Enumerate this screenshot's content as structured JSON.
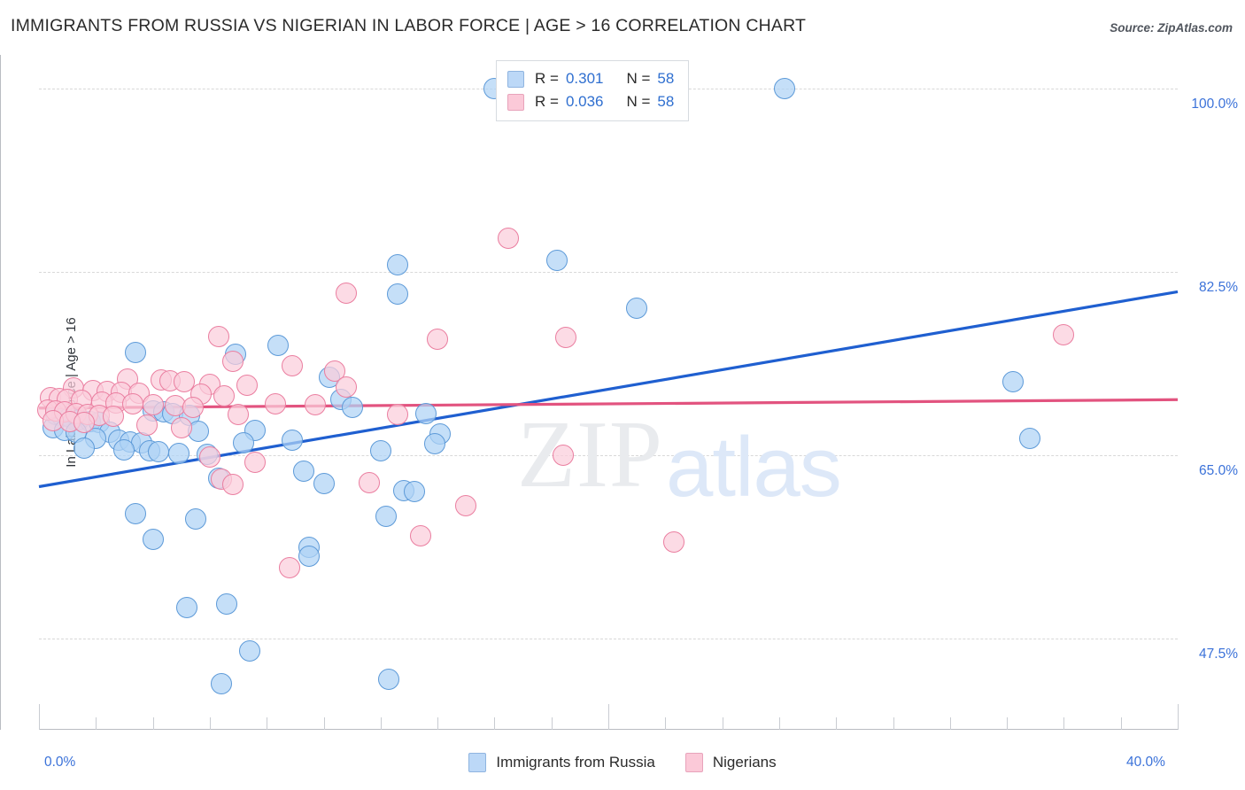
{
  "header": {
    "title": "IMMIGRANTS FROM RUSSIA VS NIGERIAN IN LABOR FORCE | AGE > 16 CORRELATION CHART",
    "source": "Source: ZipAtlas.com"
  },
  "watermark": {
    "part1": "ZIP",
    "part2": "atlas"
  },
  "stats_legend": {
    "rows": [
      {
        "swatch": "blue-swatch",
        "r_label": "R =",
        "r_value": "0.301",
        "n_label": "N =",
        "n_value": "58"
      },
      {
        "swatch": "pink-swatch",
        "r_label": "R =",
        "r_value": "0.036",
        "n_label": "N =",
        "n_value": "58"
      }
    ]
  },
  "series_legend": [
    {
      "label": "Immigrants from Russia",
      "color": "#bcd8f7"
    },
    {
      "label": "Nigerians",
      "color": "#fbc9d8"
    }
  ],
  "colors": {
    "blue_fill": "#afd2f5",
    "blue_stroke": "#5d9ad8",
    "pink_fill": "#fbcddb",
    "pink_stroke": "#ea7ea0",
    "blue_trend": "#1f5fd0",
    "pink_trend": "#e2537f",
    "tick_text": "#3b72d9",
    "grid": "#d8d8d8"
  },
  "chart_data": {
    "type": "scatter",
    "title": "IMMIGRANTS FROM RUSSIA VS NIGERIAN IN LABOR FORCE | AGE > 16 CORRELATION CHART",
    "xlabel": "",
    "ylabel": "In Labor Force | Age > 16",
    "xlim": [
      0,
      40
    ],
    "ylim": [
      38.8,
      103.2
    ],
    "x_ticks": [
      0,
      40
    ],
    "x_tick_labels": [
      "0.0%",
      "40.0%"
    ],
    "y_ticks": [
      47.5,
      65.0,
      82.5,
      100.0
    ],
    "y_tick_labels": [
      "47.5%",
      "65.0%",
      "82.5%",
      "100.0%"
    ],
    "grid": true,
    "legend_position": "bottom-center",
    "series": [
      {
        "name": "Immigrants from Russia",
        "color": "#afd2f5",
        "stroke": "#5d9ad8",
        "R": 0.301,
        "N": 58,
        "trendline": {
          "x0": 0,
          "y0": 62.0,
          "x1": 40,
          "y1": 80.6
        },
        "points": [
          [
            16.0,
            100.0
          ],
          [
            26.2,
            100.0
          ],
          [
            18.2,
            83.6
          ],
          [
            12.6,
            83.2
          ],
          [
            12.6,
            80.4
          ],
          [
            21.0,
            79.0
          ],
          [
            8.4,
            75.5
          ],
          [
            3.4,
            74.8
          ],
          [
            6.9,
            74.6
          ],
          [
            10.2,
            72.4
          ],
          [
            34.2,
            72.0
          ],
          [
            10.6,
            70.3
          ],
          [
            11.0,
            69.6
          ],
          [
            4.0,
            69.2
          ],
          [
            4.4,
            69.1
          ],
          [
            4.7,
            69.0
          ],
          [
            5.3,
            68.8
          ],
          [
            13.6,
            69.0
          ],
          [
            0.6,
            68.9
          ],
          [
            0.8,
            68.7
          ],
          [
            1.1,
            68.6
          ],
          [
            1.4,
            68.4
          ],
          [
            1.8,
            68.2
          ],
          [
            2.1,
            68.1
          ],
          [
            0.5,
            67.6
          ],
          [
            0.9,
            67.4
          ],
          [
            1.3,
            67.2
          ],
          [
            2.5,
            67.2
          ],
          [
            5.6,
            67.3
          ],
          [
            7.6,
            67.4
          ],
          [
            14.1,
            67.0
          ],
          [
            34.8,
            66.6
          ],
          [
            2.0,
            66.6
          ],
          [
            2.8,
            66.4
          ],
          [
            3.2,
            66.3
          ],
          [
            3.6,
            66.2
          ],
          [
            7.2,
            66.2
          ],
          [
            8.9,
            66.4
          ],
          [
            13.9,
            66.1
          ],
          [
            1.6,
            65.7
          ],
          [
            3.0,
            65.5
          ],
          [
            3.9,
            65.4
          ],
          [
            4.2,
            65.3
          ],
          [
            4.9,
            65.2
          ],
          [
            5.9,
            65.1
          ],
          [
            12.0,
            65.4
          ],
          [
            9.3,
            63.5
          ],
          [
            6.3,
            62.8
          ],
          [
            10.0,
            62.3
          ],
          [
            12.8,
            61.6
          ],
          [
            13.2,
            61.5
          ],
          [
            3.4,
            59.4
          ],
          [
            5.5,
            58.9
          ],
          [
            12.2,
            59.2
          ],
          [
            4.0,
            57.0
          ],
          [
            9.5,
            56.2
          ],
          [
            9.5,
            55.4
          ],
          [
            5.2,
            50.5
          ],
          [
            6.6,
            50.8
          ],
          [
            7.4,
            46.3
          ],
          [
            12.3,
            43.6
          ],
          [
            6.4,
            43.2
          ]
        ]
      },
      {
        "name": "Nigerians",
        "color": "#fbcddb",
        "stroke": "#ea7ea0",
        "R": 0.036,
        "N": 58,
        "trendline": {
          "x0": 0,
          "y0": 69.5,
          "x1": 40,
          "y1": 70.3
        },
        "points": [
          [
            16.5,
            85.7
          ],
          [
            10.8,
            80.5
          ],
          [
            6.3,
            76.3
          ],
          [
            18.5,
            76.2
          ],
          [
            14.0,
            76.1
          ],
          [
            36.0,
            76.5
          ],
          [
            6.8,
            74.0
          ],
          [
            8.9,
            73.5
          ],
          [
            10.4,
            73.0
          ],
          [
            3.1,
            72.3
          ],
          [
            4.3,
            72.2
          ],
          [
            4.6,
            72.1
          ],
          [
            5.1,
            72.0
          ],
          [
            6.0,
            71.8
          ],
          [
            7.3,
            71.7
          ],
          [
            10.8,
            71.5
          ],
          [
            1.2,
            71.4
          ],
          [
            1.9,
            71.2
          ],
          [
            2.4,
            71.1
          ],
          [
            2.9,
            71.0
          ],
          [
            3.5,
            70.9
          ],
          [
            5.7,
            70.8
          ],
          [
            6.5,
            70.7
          ],
          [
            0.4,
            70.5
          ],
          [
            0.7,
            70.4
          ],
          [
            1.0,
            70.3
          ],
          [
            1.5,
            70.2
          ],
          [
            2.2,
            70.1
          ],
          [
            2.7,
            70.0
          ],
          [
            3.3,
            69.9
          ],
          [
            4.0,
            69.8
          ],
          [
            4.8,
            69.7
          ],
          [
            5.4,
            69.6
          ],
          [
            8.3,
            69.9
          ],
          [
            9.7,
            69.8
          ],
          [
            0.3,
            69.3
          ],
          [
            0.6,
            69.2
          ],
          [
            0.9,
            69.1
          ],
          [
            1.3,
            69.0
          ],
          [
            1.7,
            68.9
          ],
          [
            2.1,
            68.8
          ],
          [
            2.6,
            68.7
          ],
          [
            7.0,
            68.9
          ],
          [
            12.6,
            68.9
          ],
          [
            0.5,
            68.3
          ],
          [
            1.1,
            68.2
          ],
          [
            1.6,
            68.1
          ],
          [
            3.8,
            67.9
          ],
          [
            5.0,
            67.6
          ],
          [
            18.4,
            65.0
          ],
          [
            6.0,
            64.8
          ],
          [
            7.6,
            64.3
          ],
          [
            6.4,
            62.7
          ],
          [
            6.8,
            62.2
          ],
          [
            11.6,
            62.4
          ],
          [
            15.0,
            60.2
          ],
          [
            13.4,
            57.3
          ],
          [
            22.3,
            56.7
          ],
          [
            8.8,
            54.3
          ]
        ]
      }
    ]
  }
}
